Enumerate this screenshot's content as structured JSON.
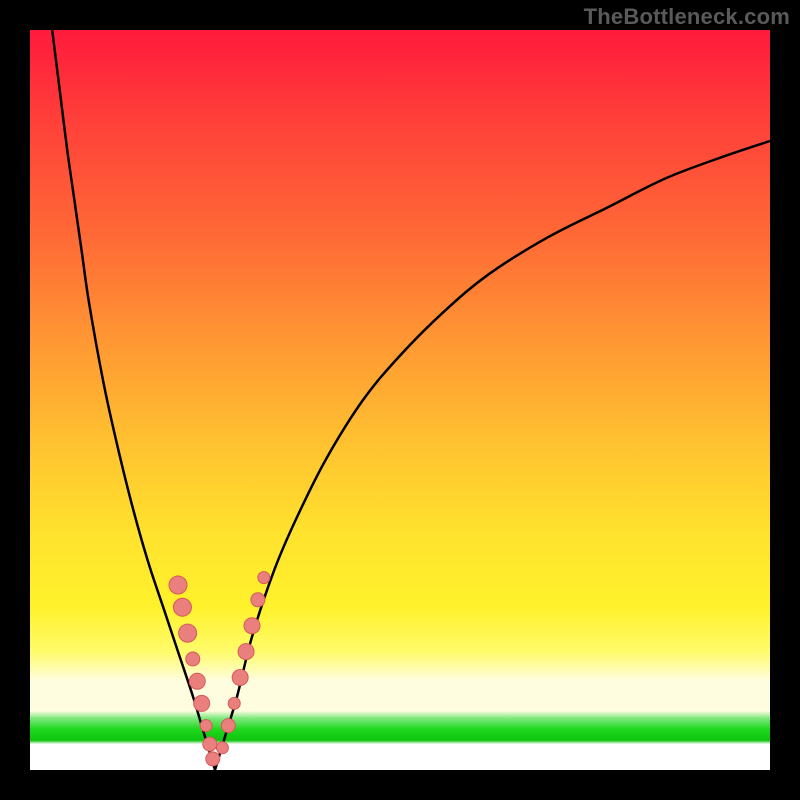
{
  "branding": "TheBottleneck.com",
  "colors": {
    "frame": "#000000",
    "curve": "#000000",
    "marker_fill": "#e9807d",
    "marker_stroke": "#d55a58"
  },
  "chart_data": {
    "type": "line",
    "title": "",
    "xlabel": "",
    "ylabel": "",
    "xlim": [
      0,
      100
    ],
    "ylim": [
      0,
      100
    ],
    "grid": false,
    "series": [
      {
        "name": "left-branch",
        "x": [
          3,
          4,
          5,
          6,
          7,
          8,
          10,
          12,
          14,
          16,
          18,
          20,
          22,
          23.5,
          25
        ],
        "y": [
          100,
          92,
          84,
          77,
          70,
          63,
          52,
          43,
          35,
          28,
          22,
          16,
          10,
          5,
          0
        ]
      },
      {
        "name": "right-branch",
        "x": [
          25,
          26.5,
          28,
          30,
          33,
          36,
          40,
          45,
          50,
          56,
          62,
          70,
          78,
          86,
          94,
          100
        ],
        "y": [
          0,
          5,
          10,
          18,
          27,
          34,
          42,
          50,
          56,
          62,
          67,
          72,
          76,
          80,
          83,
          85
        ]
      }
    ],
    "markers": {
      "name": "highlight-dots",
      "points": [
        {
          "x": 20.0,
          "y": 25.0,
          "r": 9
        },
        {
          "x": 20.6,
          "y": 22.0,
          "r": 9
        },
        {
          "x": 21.3,
          "y": 18.5,
          "r": 9
        },
        {
          "x": 22.0,
          "y": 15.0,
          "r": 7
        },
        {
          "x": 22.6,
          "y": 12.0,
          "r": 8
        },
        {
          "x": 23.2,
          "y": 9.0,
          "r": 8
        },
        {
          "x": 23.8,
          "y": 6.0,
          "r": 6
        },
        {
          "x": 24.3,
          "y": 3.5,
          "r": 7
        },
        {
          "x": 24.7,
          "y": 1.5,
          "r": 7
        },
        {
          "x": 26.0,
          "y": 3.0,
          "r": 6
        },
        {
          "x": 26.8,
          "y": 6.0,
          "r": 7
        },
        {
          "x": 27.6,
          "y": 9.0,
          "r": 6
        },
        {
          "x": 28.4,
          "y": 12.5,
          "r": 8
        },
        {
          "x": 29.2,
          "y": 16.0,
          "r": 8
        },
        {
          "x": 30.0,
          "y": 19.5,
          "r": 8
        },
        {
          "x": 30.8,
          "y": 23.0,
          "r": 7
        },
        {
          "x": 31.6,
          "y": 26.0,
          "r": 6
        }
      ]
    }
  }
}
